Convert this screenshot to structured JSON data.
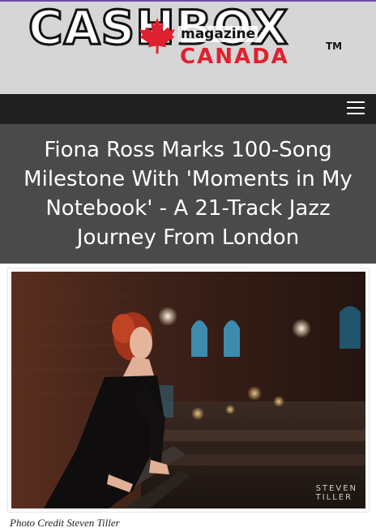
{
  "header": {
    "logo_word": "CASHBOX",
    "logo_magazine": "magazine",
    "logo_country": "CANADA",
    "logo_tm": "TM",
    "brand_red": "#e0202f"
  },
  "nav": {
    "menu_icon": "hamburger-menu-icon"
  },
  "article": {
    "title": "Fiona Ross Marks 100-Song Milestone With 'Moments in My Notebook' - A 21-Track Jazz Journey From London",
    "photo_watermark_line1": "STEVEN",
    "photo_watermark_line2": "TILLER",
    "photo_credit": "Photo Credit Steven Tiller"
  }
}
